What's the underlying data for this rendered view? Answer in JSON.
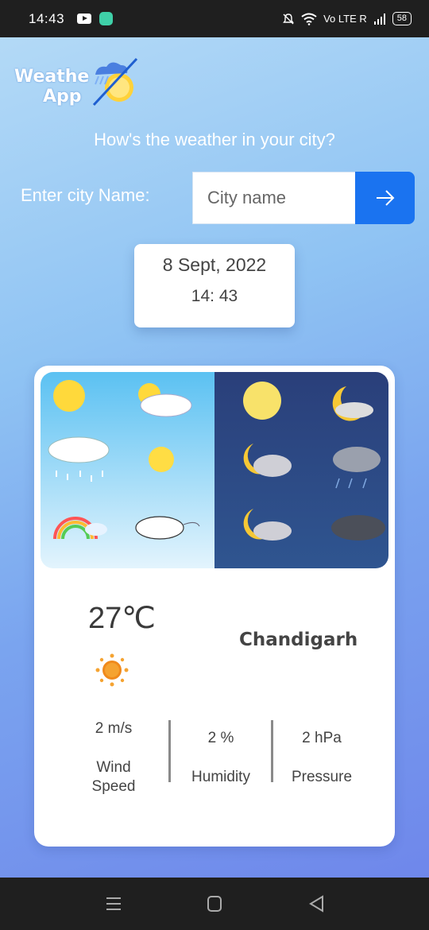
{
  "status_bar": {
    "time": "14:43",
    "network": "Vo LTE R",
    "battery": "58",
    "icons": [
      "youtube-icon",
      "message-icon",
      "mute-icon",
      "wifi-icon",
      "signal-icon",
      "battery-icon"
    ]
  },
  "logo": {
    "line1": "Weathe",
    "line2": "App"
  },
  "tagline": "How's the weather in your city?",
  "search": {
    "label": "Enter city Name:",
    "placeholder": "City name",
    "value": "",
    "button_icon": "arrow-right-icon"
  },
  "datetime": {
    "date": "8 Sept, 2022",
    "time": "14: 43"
  },
  "weather": {
    "temperature": "27℃",
    "condition_icon": "sun-icon",
    "city": "Chandigarh",
    "stats": [
      {
        "value": "2 m/s",
        "label_line1": "Wind",
        "label_line2": "Speed"
      },
      {
        "value": "2 %",
        "label_line1": "Humidity",
        "label_line2": ""
      },
      {
        "value": "2 hPa",
        "label_line1": "Pressure",
        "label_line2": ""
      }
    ]
  },
  "nav_bar": {
    "icons": [
      "recent-apps-icon",
      "home-icon",
      "back-icon"
    ]
  },
  "colors": {
    "accent": "#1a73f0",
    "status_bar": "#1f1f1f"
  }
}
